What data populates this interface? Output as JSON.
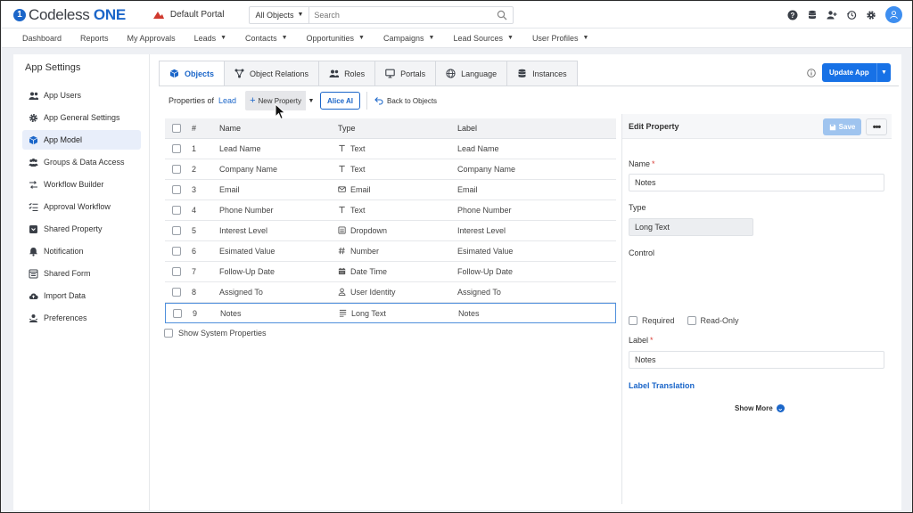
{
  "header": {
    "brand": {
      "prefix": "Codeless",
      "suffix": "ONE"
    },
    "portal_name": "Default Portal",
    "object_select": "All Objects",
    "search_placeholder": "Search"
  },
  "nav": {
    "items": [
      {
        "label": "Dashboard",
        "has_dropdown": false
      },
      {
        "label": "Reports",
        "has_dropdown": false
      },
      {
        "label": "My Approvals",
        "has_dropdown": false
      },
      {
        "label": "Leads",
        "has_dropdown": true
      },
      {
        "label": "Contacts",
        "has_dropdown": true
      },
      {
        "label": "Opportunities",
        "has_dropdown": true
      },
      {
        "label": "Campaigns",
        "has_dropdown": true
      },
      {
        "label": "Lead Sources",
        "has_dropdown": true
      },
      {
        "label": "User Profiles",
        "has_dropdown": true
      }
    ]
  },
  "sidebar": {
    "title": "App Settings",
    "items": [
      {
        "label": "App Users",
        "icon": "users-icon"
      },
      {
        "label": "App General Settings",
        "icon": "gear-icon"
      },
      {
        "label": "App Model",
        "icon": "cube-icon",
        "active": true
      },
      {
        "label": "Groups & Data Access",
        "icon": "group-icon"
      },
      {
        "label": "Workflow Builder",
        "icon": "workflow-icon"
      },
      {
        "label": "Approval Workflow",
        "icon": "checklist-icon"
      },
      {
        "label": "Shared Property",
        "icon": "shared-property-icon"
      },
      {
        "label": "Notification",
        "icon": "bell-icon"
      },
      {
        "label": "Shared Form",
        "icon": "form-icon"
      },
      {
        "label": "Import Data",
        "icon": "cloud-upload-icon"
      },
      {
        "label": "Preferences",
        "icon": "preferences-icon"
      }
    ]
  },
  "tabs": [
    {
      "label": "Objects",
      "icon": "cube-icon",
      "active": true
    },
    {
      "label": "Object Relations",
      "icon": "relations-icon"
    },
    {
      "label": "Roles",
      "icon": "users-icon"
    },
    {
      "label": "Portals",
      "icon": "monitor-icon"
    },
    {
      "label": "Language",
      "icon": "globe-icon"
    },
    {
      "label": "Instances",
      "icon": "database-icon"
    }
  ],
  "update_button": "Update App",
  "toolbar": {
    "properties_of": "Properties of",
    "object_link": "Lead",
    "new_property": "New Property",
    "alice_ai": "Alice AI",
    "back": "Back to Objects"
  },
  "table": {
    "headers": {
      "num": "#",
      "name": "Name",
      "type": "Type",
      "label": "Label"
    },
    "rows": [
      {
        "num": "1",
        "name": "Lead Name",
        "type": "Text",
        "type_icon": "text-icon",
        "label": "Lead Name"
      },
      {
        "num": "2",
        "name": "Company Name",
        "type": "Text",
        "type_icon": "text-icon",
        "label": "Company Name"
      },
      {
        "num": "3",
        "name": "Email",
        "type": "Email",
        "type_icon": "email-icon",
        "label": "Email"
      },
      {
        "num": "4",
        "name": "Phone Number",
        "type": "Text",
        "type_icon": "text-icon",
        "label": "Phone Number"
      },
      {
        "num": "5",
        "name": "Interest Level",
        "type": "Dropdown",
        "type_icon": "dropdown-icon",
        "label": "Interest Level"
      },
      {
        "num": "6",
        "name": "Esimated Value",
        "type": "Number",
        "type_icon": "number-icon",
        "label": "Esimated Value"
      },
      {
        "num": "7",
        "name": "Follow-Up Date",
        "type": "Date Time",
        "type_icon": "calendar-icon",
        "label": "Follow-Up Date"
      },
      {
        "num": "8",
        "name": "Assigned To",
        "type": "User Identity",
        "type_icon": "user-icon",
        "label": "Assigned To"
      },
      {
        "num": "9",
        "name": "Notes",
        "type": "Long Text",
        "type_icon": "long-text-icon",
        "label": "Notes",
        "selected": true
      }
    ],
    "show_system": "Show System Properties"
  },
  "edit": {
    "title": "Edit Property",
    "save": "Save",
    "name_label": "Name",
    "name_value": "Notes",
    "type_label": "Type",
    "type_value": "Long Text",
    "control_label": "Control",
    "required": "Required",
    "readonly": "Read-Only",
    "label_label": "Label",
    "label_value": "Notes",
    "label_translation": "Label Translation",
    "show_more": "Show More"
  },
  "colors": {
    "accent": "#1b66c9",
    "button": "#1771e6",
    "selected_border": "#4f8fdc"
  }
}
